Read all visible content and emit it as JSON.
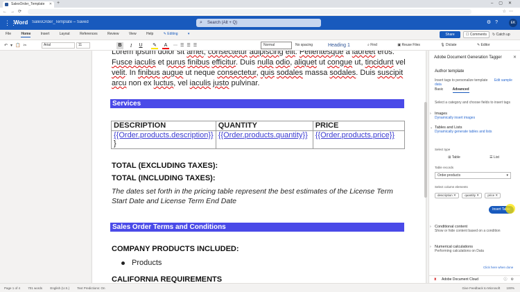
{
  "browser": {
    "tab_title": "SalesOrder_Template",
    "new_tab_icon": "plus-icon",
    "window_controls": [
      "minimize-icon",
      "maximize-icon",
      "close-icon"
    ]
  },
  "titlebar": {
    "app_name": "Word",
    "doc_name": "SalesOrder_Template",
    "doc_status": "Saved",
    "search_placeholder": "Search (Alt + Q)",
    "avatar_initials": "EK"
  },
  "menu": {
    "items": [
      "File",
      "Home",
      "Insert",
      "Layout",
      "References",
      "Review",
      "View",
      "Help"
    ],
    "active": "Home",
    "mode": "Editing",
    "share": "Share",
    "comments": "Comments",
    "catch_up": "Catch up"
  },
  "ribbon": {
    "font_name": "Arial",
    "font_size": "11",
    "bold": "B",
    "italic": "I",
    "underline": "U",
    "style_normal": "Normal",
    "style_no_spacing": "No spacing",
    "style_heading1": "Heading 1",
    "find": "Find",
    "reuse_files": "Reuse Files",
    "dictate": "Dictate",
    "editor": "Editor"
  },
  "document": {
    "para1_parts": [
      "Lorem ipsum dolor sit ",
      "amet",
      ", ",
      "consectetur",
      " ",
      "adipiscing",
      " ",
      "elit",
      ". ",
      "Pellentesque",
      " a ",
      "laoreet",
      " eros. ",
      "Fusce iaculis",
      " et ",
      "purus",
      " ",
      "finibus",
      " ",
      "efficitur",
      ". Duis ",
      "nulla",
      " ",
      "odio",
      ", ",
      "aliquet",
      " ut ",
      "congue",
      " ut, ",
      "tincidunt",
      " vel ",
      "velit",
      ". In ",
      "finibus",
      " ",
      "augue",
      " ut neque ",
      "consectetur",
      ", ",
      "quis",
      " ",
      "sodales",
      " massa ",
      "sodales",
      ". Duis ",
      "suscipit",
      " ",
      "arcu",
      " non ex ",
      "luctus",
      ", vel ",
      "iaculis",
      " ",
      "justo",
      " pulvinar."
    ],
    "services_heading": "Services",
    "table_headers": [
      "DESCRIPTION",
      "QUANTITY",
      "PRICE"
    ],
    "table_row": [
      "{{Order.products.description}}",
      "{{Order.products.quantity}}",
      "{{Order.products.price}}"
    ],
    "table_row_close": "}",
    "total_excl": "TOTAL (EXCLUDING TAXES):",
    "total_incl": "TOTAL (INCLUDING TAXES):",
    "note": "The dates set forth in the pricing table represent the best estimates of the License Term Start Date and License Term End Date",
    "terms_heading": "Sales Order Terms and Conditions",
    "company_products": "COMPANY PRODUCTS INCLUDED:",
    "bullet": "Products",
    "california": "CALIFORNIA REQUIREMENTS"
  },
  "panel": {
    "title": "Adobe Document Generation Tagger",
    "section": "Author template",
    "intro": "Insert tags to personalize template",
    "intro_link": "Edit sample data",
    "tabs": [
      "Basic",
      "Advanced"
    ],
    "active_tab": "Advanced",
    "hint": "Select a category and choose fields to insert tags",
    "images_title": "Images",
    "images_desc": "Dynamically insert images",
    "tables_title": "Tables and Lists",
    "tables_desc": "Dynamically generate tables and lists",
    "select_type": "Select type",
    "type_table": "Table",
    "type_list": "List",
    "table_records": "Table records",
    "table_records_value": "Order.products",
    "select_elements": "Select column elements",
    "chips": [
      "description",
      "quantity",
      "price"
    ],
    "insert_button": "Insert Table",
    "conditional_title": "Conditional content",
    "conditional_desc": "Show or hide content based on a condition",
    "numerical_title": "Numerical calculations",
    "numerical_desc": "Performing calculations on Data",
    "feedback": "Click here when done",
    "footer": "Adobe Document Cloud"
  },
  "statusbar": {
    "page": "Page 1 of 4",
    "words": "701 words",
    "language": "English (U.S.)",
    "predictions": "Text Predictions: On",
    "right": "Give Feedback to Microsoft",
    "zoom": "100%"
  }
}
